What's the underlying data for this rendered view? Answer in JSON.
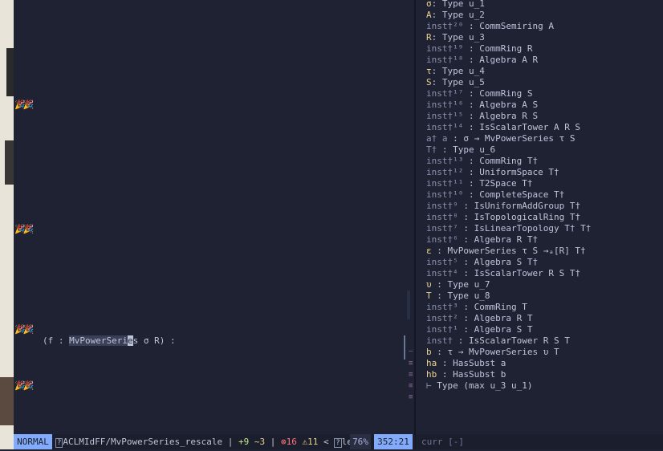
{
  "editor": {
    "code_prefix": "(f : ",
    "code_selected": "MvPowerSeri",
    "code_cursor_char": "e",
    "code_selected_tail": "s",
    "code_suffix": " σ R) :",
    "gutter_marks": [
      "🎉🎉",
      "🎉🎉",
      "🎉🎉",
      "🎉🎉"
    ]
  },
  "statusbar": {
    "mode": "NORMAL",
    "file_icon": "?",
    "file": "ACLMIdFF/MvPowerSeries_rescale",
    "sep1": "|",
    "diff_add": "+9",
    "diff_mod": "~3",
    "sep2": "|",
    "error_icon": "⊗",
    "errors": "16",
    "warning_icon": "⚠",
    "warnings": "11",
    "lt": "<",
    "lang_icon": "?",
    "lang": "lean",
    "percent": "76%",
    "position": "352:21"
  },
  "infoview": {
    "hypotheses": [
      {
        "name": "σ",
        "type": ": Type u_1",
        "style": "yellow"
      },
      {
        "name": "A",
        "type": ": Type u_2",
        "style": "yellow"
      },
      {
        "name": "inst†²⁰",
        "type": " : CommSemiring A",
        "style": "dim"
      },
      {
        "name": "R",
        "type": ": Type u_3",
        "style": "yellow"
      },
      {
        "name": "inst†¹⁹",
        "type": " : CommRing R",
        "style": "dim"
      },
      {
        "name": "inst†¹⁸",
        "type": " : Algebra A R",
        "style": "dim"
      },
      {
        "name": "τ",
        "type": ": Type u_4",
        "style": "yellow"
      },
      {
        "name": "S",
        "type": ": Type u_5",
        "style": "yellow"
      },
      {
        "name": "inst†¹⁷",
        "type": " : CommRing S",
        "style": "dim"
      },
      {
        "name": "inst†¹⁶",
        "type": " : Algebra A S",
        "style": "dim"
      },
      {
        "name": "inst†¹⁵",
        "type": " : Algebra R S",
        "style": "dim"
      },
      {
        "name": "inst†¹⁴",
        "type": " : IsScalarTower A R S",
        "style": "dim"
      },
      {
        "name": "a† a",
        "type": " : σ → MvPowerSeries τ S",
        "style": "dim"
      },
      {
        "name": "T†",
        "type": " : Type u_6",
        "style": "dim"
      },
      {
        "name": "inst†¹³",
        "type": " : CommRing T†",
        "style": "dim"
      },
      {
        "name": "inst†¹²",
        "type": " : UniformSpace T†",
        "style": "dim"
      },
      {
        "name": "inst†¹¹",
        "type": " : T2Space T†",
        "style": "dim"
      },
      {
        "name": "inst†¹⁰",
        "type": " : CompleteSpace T†",
        "style": "dim"
      },
      {
        "name": "inst†⁹",
        "type": " : IsUniformAddGroup T†",
        "style": "dim"
      },
      {
        "name": "inst†⁸",
        "type": " : IsTopologicalRing T†",
        "style": "dim"
      },
      {
        "name": "inst†⁷",
        "type": " : IsLinearTopology T† T†",
        "style": "dim"
      },
      {
        "name": "inst†⁶",
        "type": " : Algebra R T†",
        "style": "dim"
      },
      {
        "name": "ε",
        "type": " : MvPowerSeries τ S →ₐ[R] T†",
        "style": "yellow"
      },
      {
        "name": "inst†⁵",
        "type": " : Algebra S T†",
        "style": "dim"
      },
      {
        "name": "inst†⁴",
        "type": " : IsScalarTower R S T†",
        "style": "dim"
      },
      {
        "name": "υ",
        "type": " : Type u_7",
        "style": "yellow"
      },
      {
        "name": "T",
        "type": " : Type u_8",
        "style": "yellow"
      },
      {
        "name": "inst†³",
        "type": " : CommRing T",
        "style": "dim"
      },
      {
        "name": "inst†²",
        "type": " : Algebra R T",
        "style": "dim"
      },
      {
        "name": "inst†¹",
        "type": " : Algebra S T",
        "style": "dim"
      },
      {
        "name": "inst†",
        "type": " : IsScalarTower R S T",
        "style": "dim"
      },
      {
        "name": "b",
        "type": " : τ → MvPowerSeries υ T",
        "style": "yellow"
      },
      {
        "name": "ha",
        "type": " : HasSubst a",
        "style": "yellow"
      },
      {
        "name": "hb",
        "type": " : HasSubst b",
        "style": "yellow"
      },
      {
        "name": "⊢",
        "type": " Type (max u_3 u_1)",
        "style": "dim"
      }
    ],
    "footer": "curr [-]"
  },
  "colors": {
    "background": "#1f2233",
    "accent": "#82aaff",
    "hyp_name": "#e9d193",
    "error": "#ff757f"
  }
}
